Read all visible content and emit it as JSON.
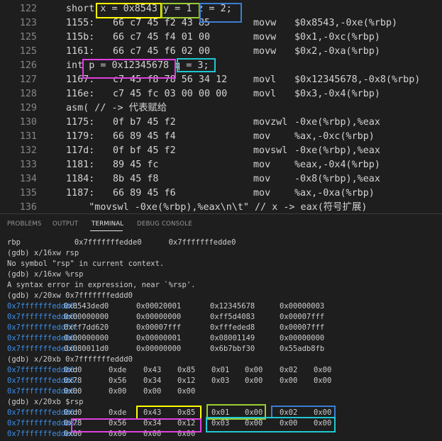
{
  "editor": {
    "lines": [
      {
        "num": "122",
        "kind": "code",
        "text": "short x = 0x8543 y = 1 z = 2;"
      },
      {
        "num": "123",
        "kind": "asm",
        "addr": "1155:",
        "bytes": "66 c7 45 f2 43 85",
        "mn": "movw",
        "op": "$0x8543,-0xe(%rbp)"
      },
      {
        "num": "125",
        "kind": "asm",
        "addr": "115b:",
        "bytes": "66 c7 45 f4 01 00",
        "mn": "movw",
        "op": "$0x1,-0xc(%rbp)"
      },
      {
        "num": "125",
        "kind": "asm",
        "addr": "1161:",
        "bytes": "66 c7 45 f6 02 00",
        "mn": "movw",
        "op": "$0x2,-0xa(%rbp)"
      },
      {
        "num": "126",
        "kind": "code",
        "text": "int p = 0x12345678 q = 3;"
      },
      {
        "num": "127",
        "kind": "asm",
        "addr": "1167:",
        "bytes": "c7 45 f8 78 56 34 12",
        "mn": "movl",
        "op": "$0x12345678,-0x8(%rbp)"
      },
      {
        "num": "128",
        "kind": "asm",
        "addr": "116e:",
        "bytes": "c7 45 fc 03 00 00 00",
        "mn": "movl",
        "op": "$0x3,-0x4(%rbp)"
      },
      {
        "num": "129",
        "kind": "code",
        "text": "asm( // -> 代表赋给"
      },
      {
        "num": "130",
        "kind": "asm",
        "addr": "1175:",
        "bytes": "0f b7 45 f2",
        "mn": "movzwl",
        "op": "-0xe(%rbp),%eax"
      },
      {
        "num": "131",
        "kind": "asm",
        "addr": "1179:",
        "bytes": "66 89 45 f4",
        "mn": "mov",
        "op": "%ax,-0xc(%rbp)"
      },
      {
        "num": "132",
        "kind": "asm",
        "addr": "117d:",
        "bytes": "0f bf 45 f2",
        "mn": "movswl",
        "op": "-0xe(%rbp),%eax"
      },
      {
        "num": "133",
        "kind": "asm",
        "addr": "1181:",
        "bytes": "89 45 fc",
        "mn": "mov",
        "op": "%eax,-0x4(%rbp)"
      },
      {
        "num": "134",
        "kind": "asm",
        "addr": "1184:",
        "bytes": "8b 45 f8",
        "mn": "mov",
        "op": "-0x8(%rbp),%eax"
      },
      {
        "num": "135",
        "kind": "asm",
        "addr": "1187:",
        "bytes": "66 89 45 f6",
        "mn": "mov",
        "op": "%ax,-0xa(%rbp)"
      },
      {
        "num": "136",
        "kind": "code",
        "text": "    \"movswl -0xe(%rbp),%eax\\n\\t\" // x -> eax(符号扩展)"
      }
    ]
  },
  "panel": {
    "tabs": [
      "PROBLEMS",
      "OUTPUT",
      "TERMINAL",
      "DEBUG CONSOLE"
    ],
    "active_tab": "TERMINAL"
  },
  "terminal": {
    "lines": [
      {
        "kind": "text",
        "text": "rbp            0x7fffffffedde0      0x7fffffffedde0"
      },
      {
        "kind": "text",
        "text": "(gdb) x/16xw rsp"
      },
      {
        "kind": "text",
        "text": "No symbol \"rsp\" in current context."
      },
      {
        "kind": "text",
        "text": "(gdb) x/16xw %rsp"
      },
      {
        "kind": "text",
        "text": "A syntax error in expression, near `%rsp'."
      },
      {
        "kind": "text",
        "text": "(gdb) x/20xw 0x7fffffffeddd0"
      },
      {
        "kind": "w",
        "addr": "0x7fffffffeddd0:",
        "vals": [
          "0x8543ded0",
          "0x00020001",
          "0x12345678",
          "0x00000003"
        ]
      },
      {
        "kind": "w",
        "addr": "0x7fffffffedde0:",
        "vals": [
          "0x00000000",
          "0x00000000",
          "0xff5d4083",
          "0x00007fff"
        ]
      },
      {
        "kind": "w",
        "addr": "0x7fffffffeddf0:",
        "vals": [
          "0xff7dd620",
          "0x00007fff",
          "0xfffeded8",
          "0x00007fff"
        ]
      },
      {
        "kind": "w",
        "addr": "0x7fffffffede00:",
        "vals": [
          "0x00000000",
          "0x00000001",
          "0x08001149",
          "0x00000000"
        ]
      },
      {
        "kind": "w",
        "addr": "0x7fffffffede10:",
        "vals": [
          "0x080011d0",
          "0x00000000",
          "0x6b7bbf30",
          "0x55adb8fb"
        ]
      },
      {
        "kind": "text",
        "text": "(gdb) x/20xb 0x7fffffffeddd0"
      },
      {
        "kind": "b",
        "addr": "0x7fffffffeddd0:",
        "vals": [
          "0xd0",
          "0xde",
          "0x43",
          "0x85",
          "0x01",
          "0x00",
          "0x02",
          "0x00"
        ]
      },
      {
        "kind": "b",
        "addr": "0x7fffffffeddd8:",
        "vals": [
          "0x78",
          "0x56",
          "0x34",
          "0x12",
          "0x03",
          "0x00",
          "0x00",
          "0x00"
        ]
      },
      {
        "kind": "b",
        "addr": "0x7fffffffedde0:",
        "vals": [
          "0x00",
          "0x00",
          "0x00",
          "0x00"
        ]
      },
      {
        "kind": "text",
        "text": "(gdb) x/20xb $rsp"
      },
      {
        "kind": "b",
        "addr": "0x7fffffffeddd0:",
        "vals": [
          "0xd0",
          "0xde",
          "0x43",
          "0x85",
          "0x01",
          "0x00",
          "0x02",
          "0x00"
        ]
      },
      {
        "kind": "b",
        "addr": "0x7fffffffeddd8:",
        "vals": [
          "0x78",
          "0x56",
          "0x34",
          "0x12",
          "0x03",
          "0x00",
          "0x00",
          "0x00"
        ]
      },
      {
        "kind": "b",
        "addr": "0x7fffffffedde0:",
        "vals": [
          "0x00",
          "0x00",
          "0x00",
          "0x00"
        ]
      }
    ]
  },
  "colors": {
    "yellow": "#ffff00",
    "green": "#9acd32",
    "blue": "#3a7fd5",
    "magenta": "#e040e0",
    "cyan": "#20c8d0",
    "address": "#3b8eea"
  }
}
